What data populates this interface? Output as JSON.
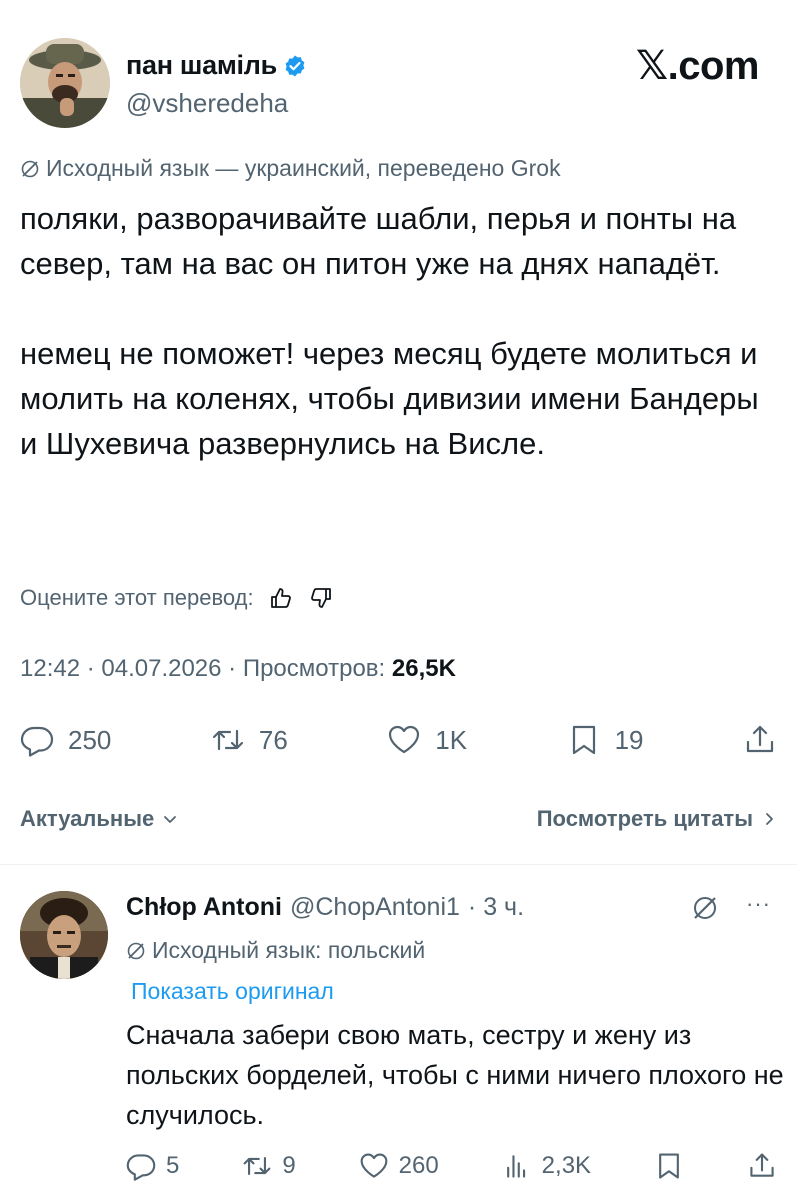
{
  "author": {
    "name": "пан шаміль",
    "handle": "@vsheredeha"
  },
  "site_logo": "𝕏.com",
  "translation": {
    "note": "Исходный язык — украинский, переведено Grok",
    "rate_label": "Оцените этот перевод:"
  },
  "tweet": {
    "paragraph1": "поляки, разворачивайте шабли, перья и понты на север, там на вас он питон уже на днях нападёт.",
    "paragraph2": "немец не поможет! через месяц будете молиться и молить на коленях, чтобы дивизии имени Бандеры и Шухевича развернулись на Висле."
  },
  "meta": {
    "time_date": "12:42 · 04.07.2026 · Просмотров: ",
    "views": "26,5K"
  },
  "actions": {
    "replies": "250",
    "reposts": "76",
    "likes": "1K",
    "bookmarks": "19"
  },
  "bar": {
    "sort_label": "Актуальные",
    "quotes_label": "Посмотреть цитаты"
  },
  "reply": {
    "name": "Chłop Antoni",
    "handle": "@ChopAntoni1",
    "time": "· 3 ч.",
    "more": "···",
    "translate_note": "Исходный язык: польский",
    "show_original": "Показать оригинал",
    "text": "Сначала забери свою мать, сестру и жену из польских борделей, чтобы с ними ничего плохого не случилось.",
    "actions": {
      "replies": "5",
      "reposts": "9",
      "likes": "260",
      "views": "2,3K"
    }
  },
  "colors": {
    "text": "#0f1419",
    "secondary": "#536471",
    "link": "#1d9bf0",
    "verified": "#1d9bf0"
  }
}
